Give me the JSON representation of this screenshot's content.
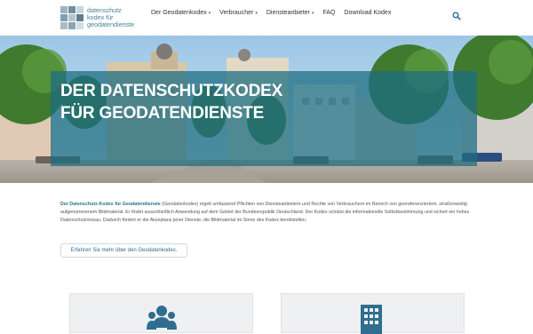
{
  "logo": {
    "line1": "datenschutz",
    "line2": "kodex für",
    "line3": "geodatendienste",
    "tile_colors": [
      "#9bb3c2",
      "#6f8fa3",
      "#c9d5dc",
      "#7fa0b4",
      "#b5c6d0",
      "#5e7f94",
      "#aabcc7",
      "#8aa6b7",
      "#d3dde3"
    ]
  },
  "nav": {
    "items": [
      {
        "label": "Der Geodatenkodex",
        "dropdown": true
      },
      {
        "label": "Verbraucher",
        "dropdown": true
      },
      {
        "label": "Diensteanbieter",
        "dropdown": true
      },
      {
        "label": "FAQ",
        "dropdown": false
      },
      {
        "label": "Download Kodex",
        "dropdown": false
      }
    ],
    "caret": "▾",
    "search_icon": "search-icon"
  },
  "hero": {
    "title_line1": "DER DATENSCHUTZKODEX",
    "title_line2": "FÜR GEODATENDIENSTE",
    "overlay_color": "#1e6e82"
  },
  "intro": {
    "bold": "Der Datenschutz-Kodex für Geodatendienste",
    "text": " (Geodatenkodex) regelt umfassend Pflichten von Diensteanbietern und Rechte von Verbrauchern im Bereich von georeferenziertem, straßenweitig aufgenommenem Bildmaterial. Er findet ausschließlich Anwendung auf dem Gebiet der Bundesrepublik Deutschland. Der Kodex schützt die informationelle Selbstbestimmung und sichert ein hohes Datenschutzniveau. Dadurch fördert er die Akzeptanz jener Dienste, die Bildmaterial im Sinne des Kodex bereitstellen."
  },
  "more_button": "Erfahren Sie mehr über den Geodatenkodex.",
  "cards": {
    "card1_icon": "users-group-icon",
    "card2_icon": "office-building-icon",
    "icon_color": "#2f6e8f"
  }
}
